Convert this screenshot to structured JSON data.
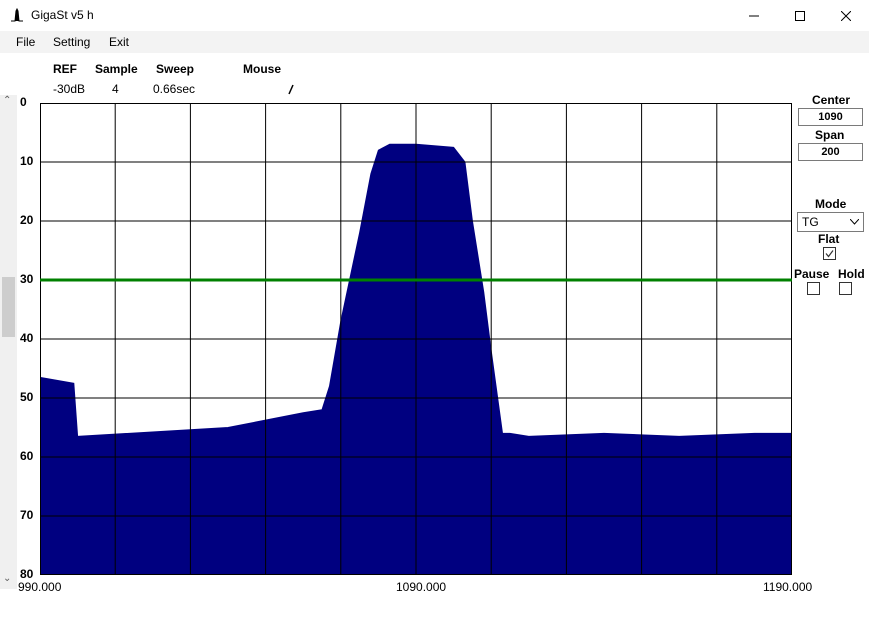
{
  "window": {
    "title": "GigaSt v5 h"
  },
  "menu": {
    "items": [
      "File",
      "Setting",
      "Exit"
    ]
  },
  "header": {
    "ref_label": "REF",
    "ref_value": "-30dB",
    "sample_label": "Sample",
    "sample_value": "4",
    "sweep_label": "Sweep",
    "sweep_value": "0.66sec",
    "mouse_label": "Mouse"
  },
  "sidebar": {
    "center_label": "Center",
    "center_value": "1090",
    "span_label": "Span",
    "span_value": "200",
    "mode_label": "Mode",
    "mode_value": "TG",
    "flat_label": "Flat",
    "flat_checked": true,
    "pause_label": "Pause",
    "pause_checked": false,
    "hold_label": "Hold",
    "hold_checked": false
  },
  "colors": {
    "trace": "#000080",
    "ref_line": "#008000",
    "grid": "#000000",
    "background": "#ffffff"
  },
  "chart_data": {
    "type": "area",
    "x_ticks": [
      "990.000",
      "1090.000",
      "1190.000"
    ],
    "y_ticks": [
      "0",
      "10",
      "20",
      "30",
      "40",
      "50",
      "60",
      "70",
      "80"
    ],
    "xlim": [
      990,
      1190
    ],
    "ylim": [
      0,
      80
    ],
    "ref_line_y": 30,
    "grid": true,
    "x": [
      990,
      999,
      1000,
      1040,
      1060,
      1065,
      1067,
      1070,
      1075,
      1078,
      1080,
      1083,
      1090,
      1100,
      1103,
      1105,
      1108,
      1110,
      1113,
      1115,
      1120,
      1140,
      1160,
      1180,
      1190
    ],
    "y": [
      46.5,
      47.5,
      56.5,
      55,
      52.5,
      52,
      48,
      37,
      22,
      12,
      8,
      7,
      7,
      7.5,
      10,
      20,
      32,
      42,
      56,
      56,
      56.5,
      56,
      56.5,
      56,
      56
    ]
  }
}
